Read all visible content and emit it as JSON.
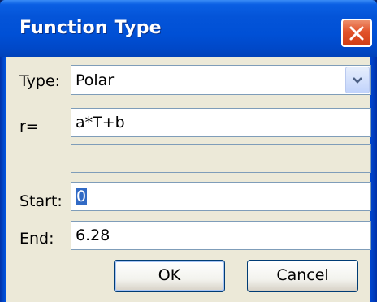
{
  "dialog": {
    "title": "Function Type"
  },
  "form": {
    "type_label": "Type:",
    "type_value": "Polar",
    "r_label": "r=",
    "r_value": "a*T+b",
    "extra_value": "",
    "start_label": "Start:",
    "start_value": "0",
    "end_label": "End:",
    "end_value": "6.28"
  },
  "buttons": {
    "ok_label": "OK",
    "cancel_label": "Cancel"
  },
  "icons": {
    "close": "close-x-icon",
    "dropdown": "chevron-down-icon"
  },
  "colors": {
    "title_bar": "#0054e3",
    "close_button": "#e2532b",
    "client_background": "#ece9d8",
    "selection": "#316ac5"
  }
}
